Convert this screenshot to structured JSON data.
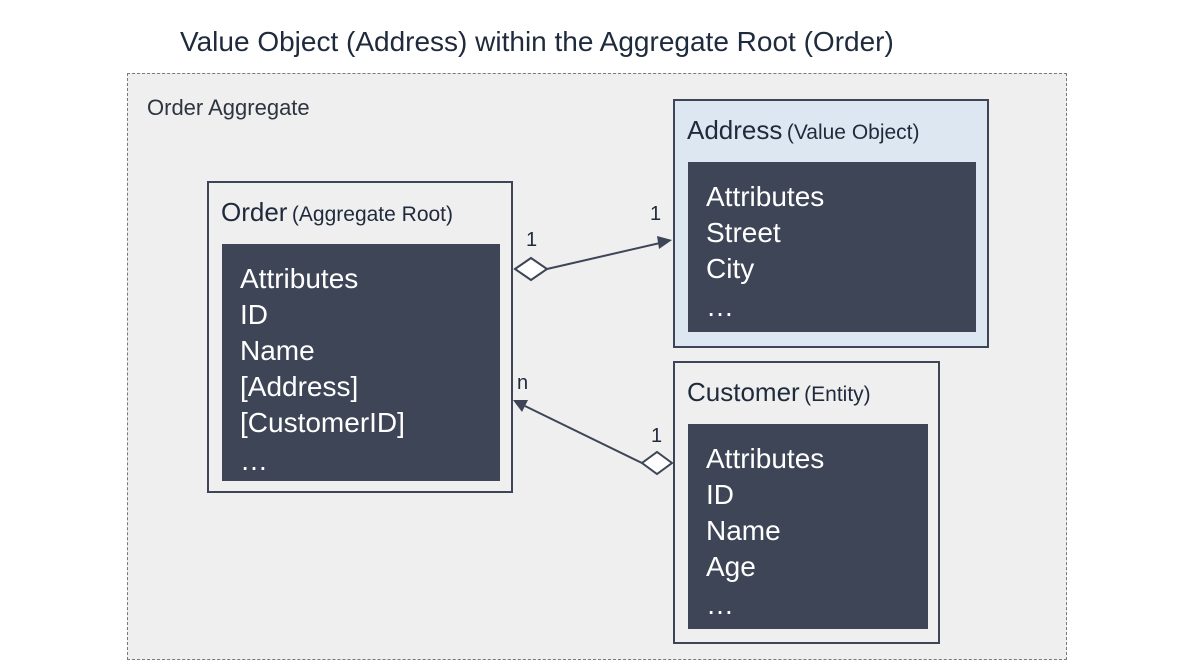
{
  "title": "Value Object (Address) within the Aggregate Root (Order)",
  "aggregate": {
    "label": "Order Aggregate"
  },
  "order": {
    "name": "Order",
    "stereotype": "(Aggregate Root)",
    "attributes": [
      "Attributes",
      "ID",
      "Name",
      "[Address]",
      "[CustomerID]",
      "…"
    ]
  },
  "address": {
    "name": "Address",
    "stereotype": "(Value Object)",
    "attributes": [
      "Attributes",
      "Street",
      "City",
      "…"
    ]
  },
  "customer": {
    "name": "Customer",
    "stereotype": "(Entity)",
    "attributes": [
      "Attributes",
      "ID",
      "Name",
      "Age",
      "…"
    ]
  },
  "relations": {
    "order_address": {
      "source_multiplicity": "1",
      "target_multiplicity": "1"
    },
    "customer_order": {
      "source_multiplicity": "1",
      "target_multiplicity": "n"
    }
  },
  "colors": {
    "attribute_panel": "#3e4556",
    "value_object_fill": "#dde7f1",
    "aggregate_fill": "#efefef"
  }
}
